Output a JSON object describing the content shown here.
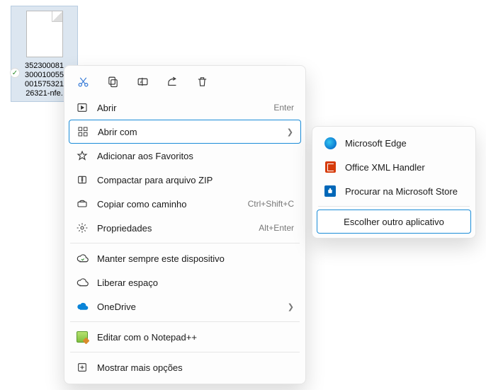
{
  "file": {
    "name_line1": "352300081",
    "name_line2": "300010055",
    "name_line3": "001575321",
    "name_line4": "26321-nfe."
  },
  "toolbar": {
    "cut": "cut",
    "copy": "copy",
    "rename": "rename",
    "share": "share",
    "delete": "delete"
  },
  "menu": {
    "open": "Abrir",
    "open_accel": "Enter",
    "open_with": "Abrir com",
    "favorites": "Adicionar aos Favoritos",
    "zip": "Compactar para arquivo ZIP",
    "copy_path": "Copiar como caminho",
    "copy_path_accel": "Ctrl+Shift+C",
    "properties": "Propriedades",
    "properties_accel": "Alt+Enter",
    "keep_device": "Manter sempre este dispositivo",
    "free_space": "Liberar espaço",
    "onedrive": "OneDrive",
    "notepadpp": "Editar com o Notepad++",
    "show_more": "Mostrar mais opções"
  },
  "submenu": {
    "edge": "Microsoft Edge",
    "office_xml": "Office XML Handler",
    "ms_store": "Procurar na Microsoft Store",
    "choose_other": "Escolher outro aplicativo"
  }
}
